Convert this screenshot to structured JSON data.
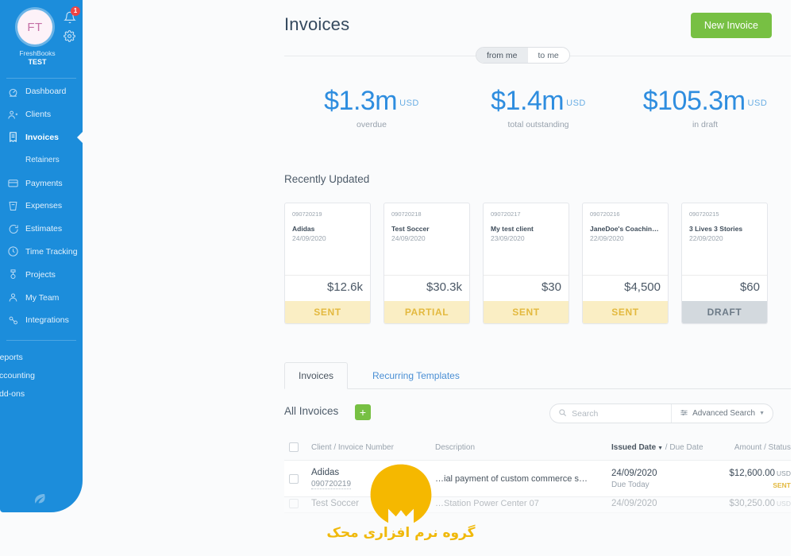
{
  "sidebar": {
    "avatar_initials": "FT",
    "brand_line1": "FreshBooks",
    "brand_line2": "TEST",
    "notification_count": "1",
    "items": [
      {
        "label": "Dashboard",
        "icon": "dashboard-icon"
      },
      {
        "label": "Clients",
        "icon": "clients-icon"
      },
      {
        "label": "Invoices",
        "icon": "invoices-icon"
      },
      {
        "label": "Retainers",
        "icon": "none"
      },
      {
        "label": "Payments",
        "icon": "payments-icon"
      },
      {
        "label": "Expenses",
        "icon": "expenses-icon"
      },
      {
        "label": "Estimates",
        "icon": "estimates-icon"
      },
      {
        "label": "Time Tracking",
        "icon": "clock-icon"
      },
      {
        "label": "Projects",
        "icon": "projects-icon"
      },
      {
        "label": "My Team",
        "icon": "team-icon"
      },
      {
        "label": "Integrations",
        "icon": "integrations-icon"
      }
    ],
    "lower_items": [
      {
        "label": "Reports"
      },
      {
        "label": "Accounting"
      },
      {
        "label": "Add-ons"
      }
    ],
    "bg_color": "#1c8ddb"
  },
  "header": {
    "title": "Invoices",
    "new_invoice_label": "New Invoice",
    "new_invoice_color": "#77c043",
    "toggle": {
      "from_me": "from me",
      "to_me": "to me",
      "selected": "from me"
    }
  },
  "stats": [
    {
      "amount": "$1.3m",
      "currency": "USD",
      "label": "overdue"
    },
    {
      "amount": "$1.4m",
      "currency": "USD",
      "label": "total outstanding"
    },
    {
      "amount": "$105.3m",
      "currency": "USD",
      "label": "in draft"
    }
  ],
  "recently_updated": {
    "title": "Recently Updated",
    "cards": [
      {
        "number": "090720219",
        "client": "Adidas",
        "date": "24/09/2020",
        "amount": "$12.6k",
        "status": "SENT",
        "status_kind": "sent"
      },
      {
        "number": "090720218",
        "client": "Test Soccer",
        "date": "24/09/2020",
        "amount": "$30.3k",
        "status": "PARTIAL",
        "status_kind": "partial"
      },
      {
        "number": "090720217",
        "client": "My test client",
        "date": "23/09/2020",
        "amount": "$30",
        "status": "SENT",
        "status_kind": "sent"
      },
      {
        "number": "090720216",
        "client": "JaneDoe's Coachin…",
        "date": "22/09/2020",
        "amount": "$4,500",
        "status": "SENT",
        "status_kind": "sent"
      },
      {
        "number": "090720215",
        "client": "3 Lives 3 Stories",
        "date": "22/09/2020",
        "amount": "$60",
        "status": "DRAFT",
        "status_kind": "draft"
      }
    ]
  },
  "tabs": [
    {
      "label": "Invoices",
      "active": true
    },
    {
      "label": "Recurring Templates",
      "active": false
    }
  ],
  "list": {
    "heading": "All Invoices",
    "add_label": "+",
    "search_placeholder": "Search",
    "search_value": "",
    "advanced_search_label": "Advanced Search",
    "columns": {
      "client": "Client / Invoice Number",
      "description": "Description",
      "issued": "Issued Date",
      "due": "Due Date",
      "amount": "Amount / Status"
    },
    "rows": [
      {
        "client": "Adidas",
        "invoice_number": "090720219",
        "description": "…ial payment of custom commerce s…",
        "issued_date": "24/09/2020",
        "due_text": "Due Today",
        "amount": "$12,600.00",
        "currency": "USD",
        "status": "SENT"
      },
      {
        "client": "Test Soccer",
        "invoice_number": "",
        "description": "…Station Power Center 07",
        "issued_date": "24/09/2020",
        "due_text": "",
        "amount": "$30,250.00",
        "currency": "USD",
        "status": ""
      }
    ]
  },
  "watermark": {
    "text": "گروه نرم افزاری محک",
    "color": "#f0b90b"
  }
}
